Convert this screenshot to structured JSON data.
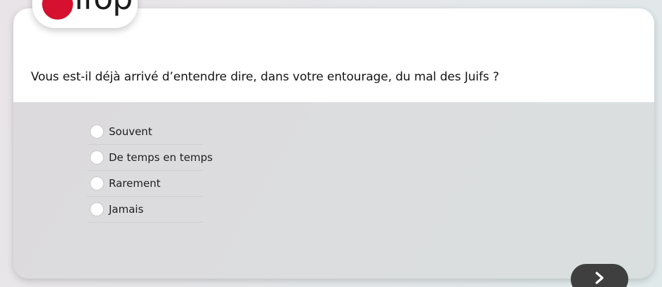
{
  "logo": {
    "text": "ifop",
    "brand_color": "#d6102f"
  },
  "question": {
    "text": "Vous est-il déjà arrivé d’entendre dire, dans votre entourage, du mal des Juifs ?"
  },
  "options": [
    {
      "label": "Souvent"
    },
    {
      "label": "De temps en temps"
    },
    {
      "label": "Rarement"
    },
    {
      "label": "Jamais"
    }
  ],
  "next_button": {
    "icon": "chevron-right-icon",
    "color": "#3f3f3f"
  }
}
